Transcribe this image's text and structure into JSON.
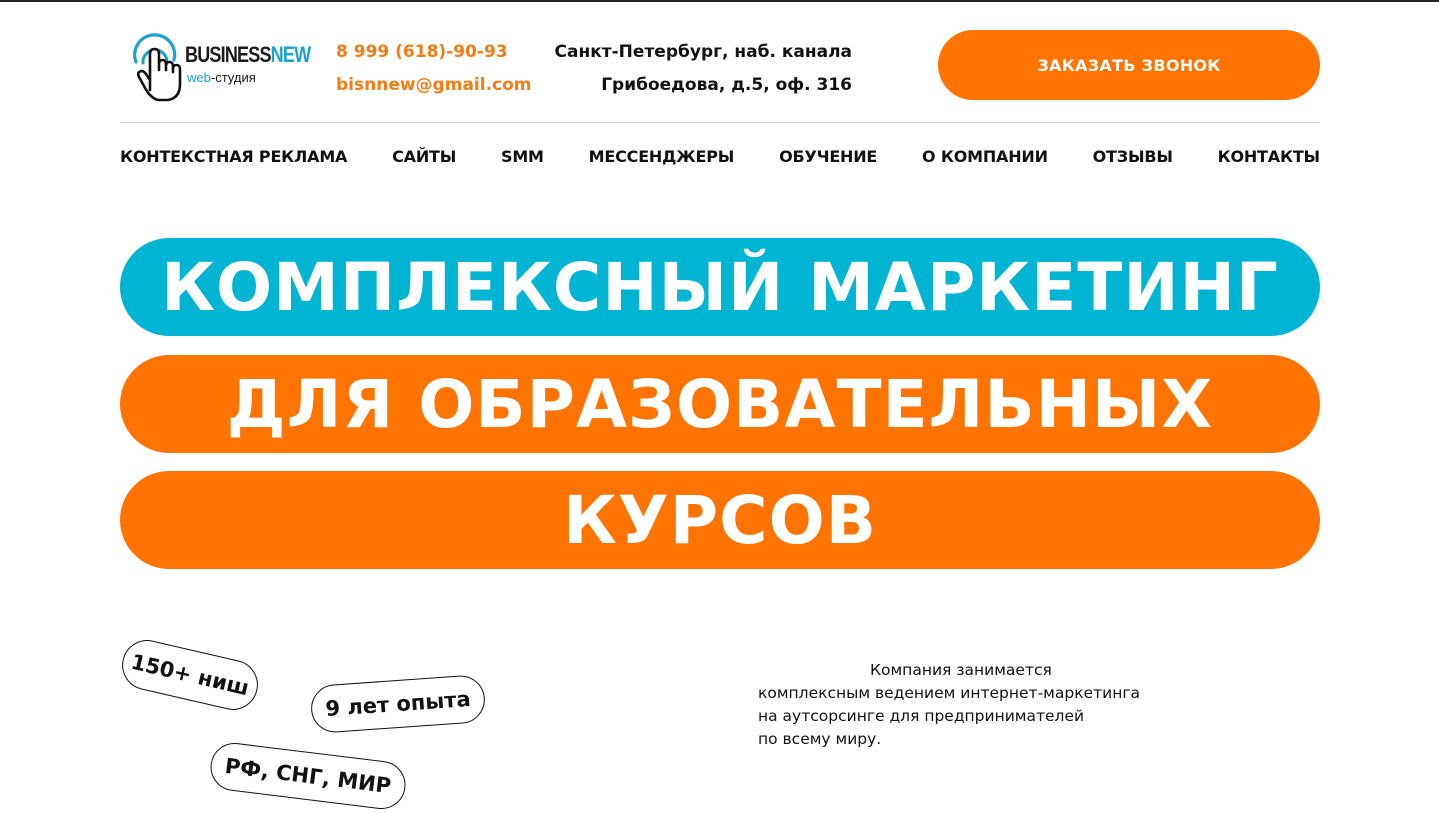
{
  "header": {
    "logo": {
      "title_part1": "BUSINESS",
      "title_part2": "NEW",
      "subtitle_part1": "web",
      "subtitle_part2": "-студия"
    },
    "phone": "8 999 (618)-90-93",
    "email": "bisnnew@gmail.com",
    "address_line1": "Санкт-Петербург, наб. канала",
    "address_line2": "Грибоедова, д.5, оф. 316",
    "call_button": "ЗАКАЗАТЬ ЗВОНОК"
  },
  "nav": {
    "items": [
      {
        "label": "КОНТЕКСТНАЯ РЕКЛАМА"
      },
      {
        "label": "САЙТЫ"
      },
      {
        "label": "SMM"
      },
      {
        "label": "МЕССЕНДЖЕРЫ"
      },
      {
        "label": "ОБУЧЕНИЕ"
      },
      {
        "label": "О КОМПАНИИ"
      },
      {
        "label": "ОТЗЫВЫ"
      },
      {
        "label": "КОНТАКТЫ"
      }
    ]
  },
  "hero": {
    "line1": "КОМПЛЕКСНЫЙ МАРКЕТИНГ",
    "line2": "ДЛЯ ОБРАЗОВАТЕЛЬНЫХ",
    "line3": "КУРСОВ"
  },
  "badges": {
    "niches": "150+ ниш",
    "experience": "9 лет опыта",
    "geography": "РФ, СНГ, МИР"
  },
  "description": {
    "line1": "Компания занимается",
    "line2": "комплексным ведением интернет-маркетинга",
    "line3": "на аутсорсинге для предпринимателей",
    "line4": "по всему миру."
  },
  "colors": {
    "accent_orange": "#ff7300",
    "accent_blue": "#00b4d4",
    "brand_blue": "#1aa3cf",
    "text_dark": "#111111"
  },
  "icons": {
    "logo_icon": "pointing-hand-click-icon"
  }
}
